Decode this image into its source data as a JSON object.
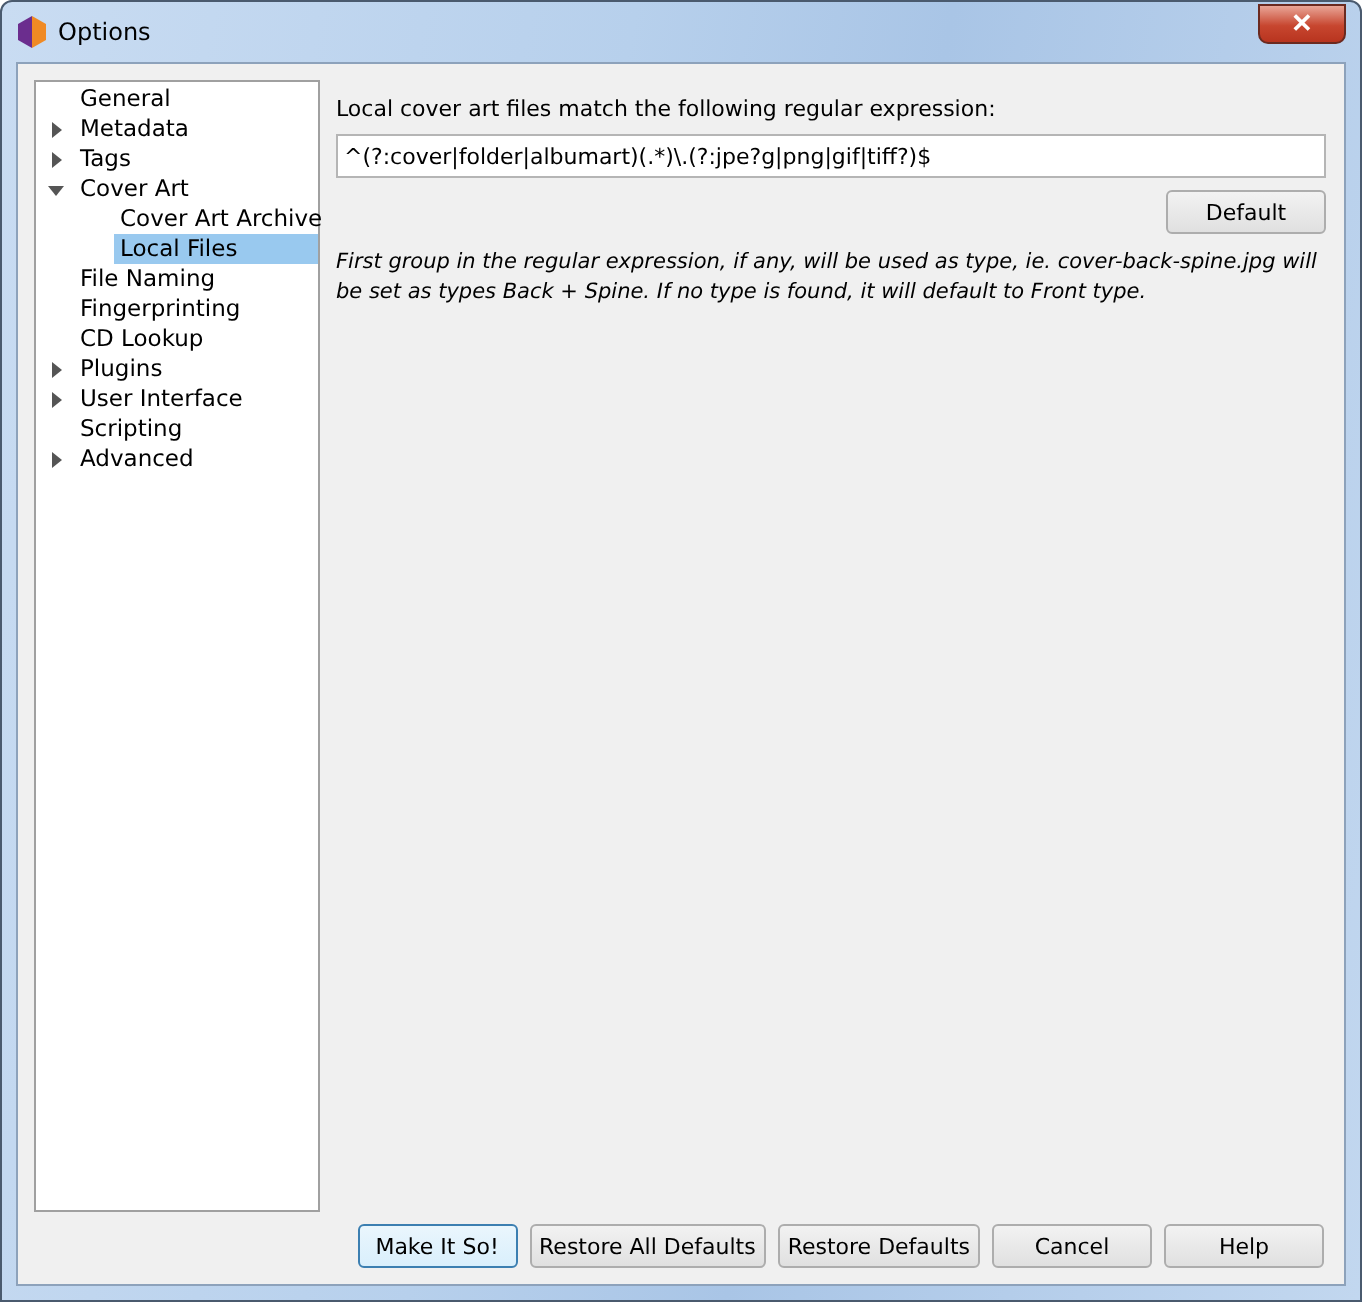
{
  "window": {
    "title": "Options",
    "close_label": "✕"
  },
  "tree": [
    {
      "label": "General",
      "selected": false
    },
    {
      "label": "Metadata",
      "expanded": false,
      "selected": false
    },
    {
      "label": "Tags",
      "expanded": false,
      "selected": false
    },
    {
      "label": "Cover Art",
      "expanded": true,
      "selected": false,
      "children": [
        {
          "label": "Cover Art Archive",
          "selected": false
        },
        {
          "label": "Local Files",
          "selected": true
        }
      ]
    },
    {
      "label": "File Naming",
      "selected": false
    },
    {
      "label": "Fingerprinting",
      "selected": false
    },
    {
      "label": "CD Lookup",
      "selected": false
    },
    {
      "label": "Plugins",
      "expanded": false,
      "selected": false
    },
    {
      "label": "User Interface",
      "expanded": false,
      "selected": false
    },
    {
      "label": "Scripting",
      "selected": false
    },
    {
      "label": "Advanced",
      "expanded": false,
      "selected": false
    }
  ],
  "panel": {
    "label": "Local cover art files match the following regular expression:",
    "value": "^(?:cover|folder|albumart)(.*)\\.(?:jpe?g|png|gif|tiff?)$",
    "default_button": "Default",
    "note": "First group in the regular expression, if any, will be used as type, ie. cover-back-spine.jpg will be set as types Back + Spine. If no type is found, it will default to Front type."
  },
  "buttons": [
    {
      "label": "Make It So!",
      "default": true
    },
    {
      "label": "Restore All Defaults",
      "default": false
    },
    {
      "label": "Restore Defaults",
      "default": false
    },
    {
      "label": "Cancel",
      "default": false
    },
    {
      "label": "Help",
      "default": false
    }
  ]
}
